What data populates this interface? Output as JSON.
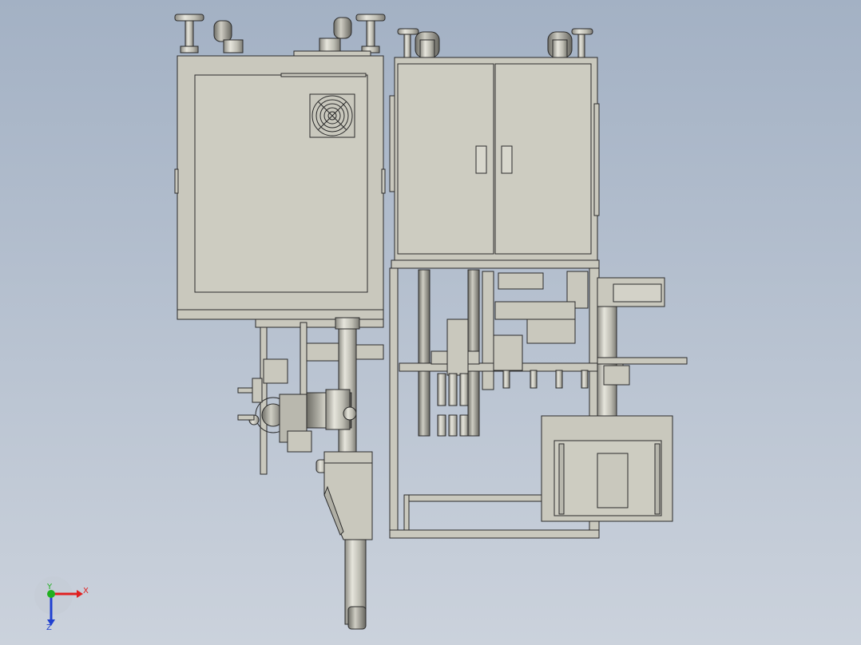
{
  "viewport": {
    "background_top": "#a3b1c4",
    "background_bottom": "#cbd2dc",
    "part_fill": "#c9c8bd",
    "part_stroke": "#2a2a2a"
  },
  "triad": {
    "x_label": "X",
    "y_label": "Y",
    "z_label": "Z",
    "x_color": "#e02020",
    "y_color": "#20b020",
    "z_color": "#2040d0"
  }
}
